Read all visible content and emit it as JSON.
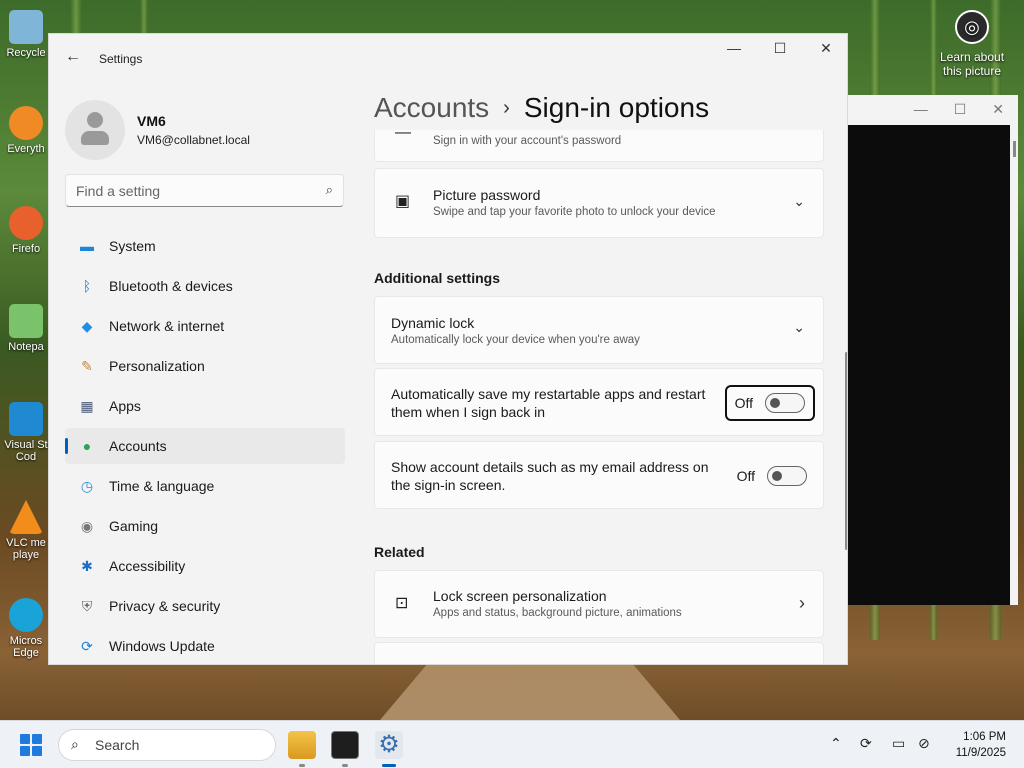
{
  "desktop": {
    "icons": [
      {
        "label": "Recycle",
        "name": "recycle-bin-icon",
        "color": "#7fb6d8"
      },
      {
        "label": "Everyth",
        "name": "everything-icon",
        "color": "#f08a24"
      },
      {
        "label": "Firefo",
        "name": "firefox-icon",
        "color": "#e8602c"
      },
      {
        "label": "Notepa",
        "name": "notepad-icon",
        "color": "#7ac36b"
      },
      {
        "label": "Visual St Cod",
        "name": "vscode-icon",
        "color": "#1f8ad2"
      },
      {
        "label": "VLC me playe",
        "name": "vlc-icon",
        "color": "#f28c1a"
      },
      {
        "label": "Micros Edge",
        "name": "edge-icon",
        "color": "#1aa3d6"
      }
    ],
    "learn": "Learn about this picture"
  },
  "settings": {
    "app_title": "Settings",
    "user": {
      "name": "VM6",
      "email": "VM6@collabnet.local"
    },
    "search_placeholder": "Find a setting",
    "nav": [
      {
        "label": "System",
        "icon": "system-icon",
        "color": "#1c86d9",
        "glyph": "▬"
      },
      {
        "label": "Bluetooth & devices",
        "icon": "bluetooth-icon",
        "color": "#1677d2",
        "glyph": "ᛒ"
      },
      {
        "label": "Network & internet",
        "icon": "network-icon",
        "color": "#1f8fe6",
        "glyph": "◆"
      },
      {
        "label": "Personalization",
        "icon": "brush-icon",
        "color": "#c9853a",
        "glyph": "✎"
      },
      {
        "label": "Apps",
        "icon": "apps-icon",
        "color": "#4a5a78",
        "glyph": "▦"
      },
      {
        "label": "Accounts",
        "icon": "accounts-icon",
        "color": "#2aa35b",
        "glyph": "●"
      },
      {
        "label": "Time & language",
        "icon": "time-language-icon",
        "color": "#2a8ed8",
        "glyph": "◷"
      },
      {
        "label": "Gaming",
        "icon": "gaming-icon",
        "color": "#777777",
        "glyph": "◉"
      },
      {
        "label": "Accessibility",
        "icon": "accessibility-icon",
        "color": "#1c6fc4",
        "glyph": "✱"
      },
      {
        "label": "Privacy & security",
        "icon": "shield-icon",
        "color": "#6b6b6b",
        "glyph": "⛨"
      },
      {
        "label": "Windows Update",
        "icon": "windows-update-icon",
        "color": "#1a7fd4",
        "glyph": "⟳"
      }
    ],
    "breadcrumb": {
      "parent": "Accounts",
      "current": "Sign-in options"
    },
    "password_partial_sub": "Sign in with your account's password",
    "picture_password": {
      "title": "Picture password",
      "sub": "Swipe and tap your favorite photo to unlock your device"
    },
    "additional_heading": "Additional settings",
    "dynamic_lock": {
      "title": "Dynamic lock",
      "sub": "Automatically lock your device when you're away"
    },
    "auto_restart": {
      "text": "Automatically save my restartable apps and restart them when I sign back in",
      "state": "Off"
    },
    "account_details": {
      "text": "Show account details such as my email address on the sign-in screen.",
      "state": "Off"
    },
    "related_heading": "Related",
    "lock_screen": {
      "title": "Lock screen personalization",
      "sub": "Apps and status, background picture, animations"
    }
  },
  "taskbar": {
    "search_label": "Search",
    "time": "1:06 PM",
    "date": "11/9/2025"
  },
  "colors": {
    "accent": "#005fb8"
  }
}
